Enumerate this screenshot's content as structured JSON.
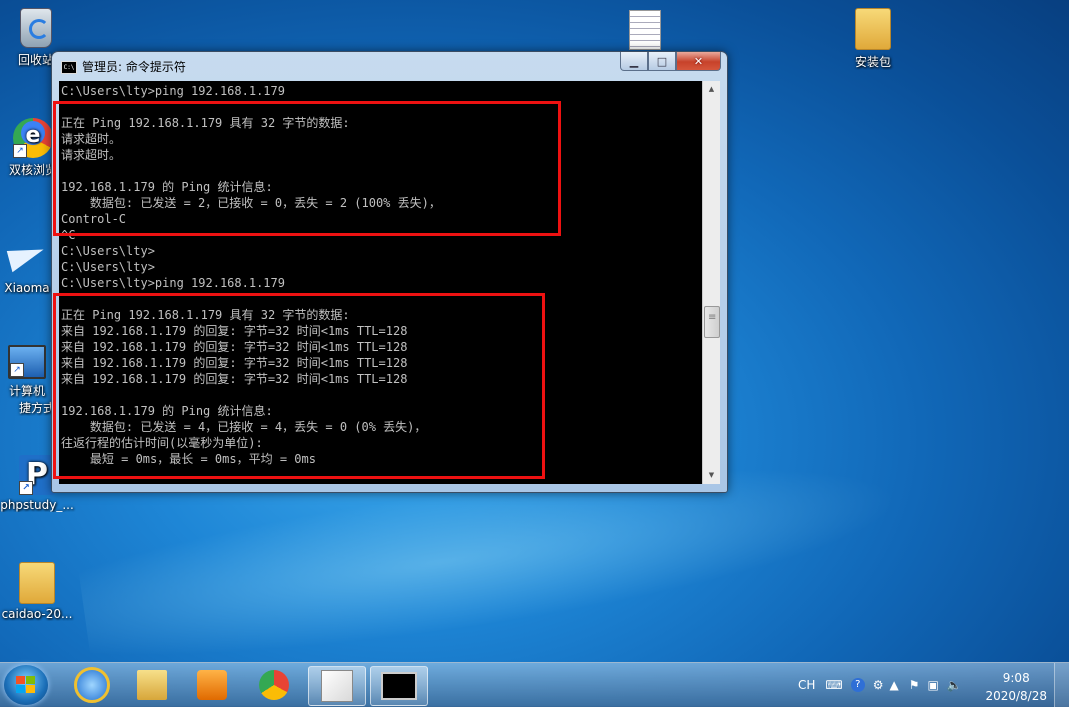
{
  "desktop": {
    "icons": [
      {
        "label": "回收站"
      },
      {
        "label": "双核浏览"
      },
      {
        "label": "Xiaoma"
      },
      {
        "label": "计算机"
      },
      {
        "label": "捷方式"
      },
      {
        "label": "phpstudy_..."
      },
      {
        "label": "caidao-20..."
      },
      {
        "label": "安装包"
      }
    ]
  },
  "window": {
    "title": "管理员: 命令提示符",
    "icon_text": "C:\\",
    "lines": [
      "C:\\Users\\lty>ping 192.168.1.179",
      "",
      "正在 Ping 192.168.1.179 具有 32 字节的数据:",
      "请求超时。",
      "请求超时。",
      "",
      "192.168.1.179 的 Ping 统计信息:",
      "    数据包: 已发送 = 2，已接收 = 0，丢失 = 2 (100% 丢失)，",
      "Control-C",
      "^C",
      "C:\\Users\\lty>",
      "C:\\Users\\lty>",
      "C:\\Users\\lty>ping 192.168.1.179",
      "",
      "正在 Ping 192.168.1.179 具有 32 字节的数据:",
      "来自 192.168.1.179 的回复: 字节=32 时间<1ms TTL=128",
      "来自 192.168.1.179 的回复: 字节=32 时间<1ms TTL=128",
      "来自 192.168.1.179 的回复: 字节=32 时间<1ms TTL=128",
      "来自 192.168.1.179 的回复: 字节=32 时间<1ms TTL=128",
      "",
      "192.168.1.179 的 Ping 统计信息:",
      "    数据包: 已发送 = 4，已接收 = 4，丢失 = 0 (0% 丢失)，",
      "往返行程的估计时间(以毫秒为单位):",
      "    最短 = 0ms，最长 = 0ms，平均 = 0ms"
    ]
  },
  "taskbar": {
    "tray_lang": "CH",
    "time": "9:08",
    "date": "2020/8/28"
  },
  "colors": {
    "highlight_box": "#ee1111",
    "console_bg": "#000000",
    "console_text": "#c0c0c0"
  }
}
